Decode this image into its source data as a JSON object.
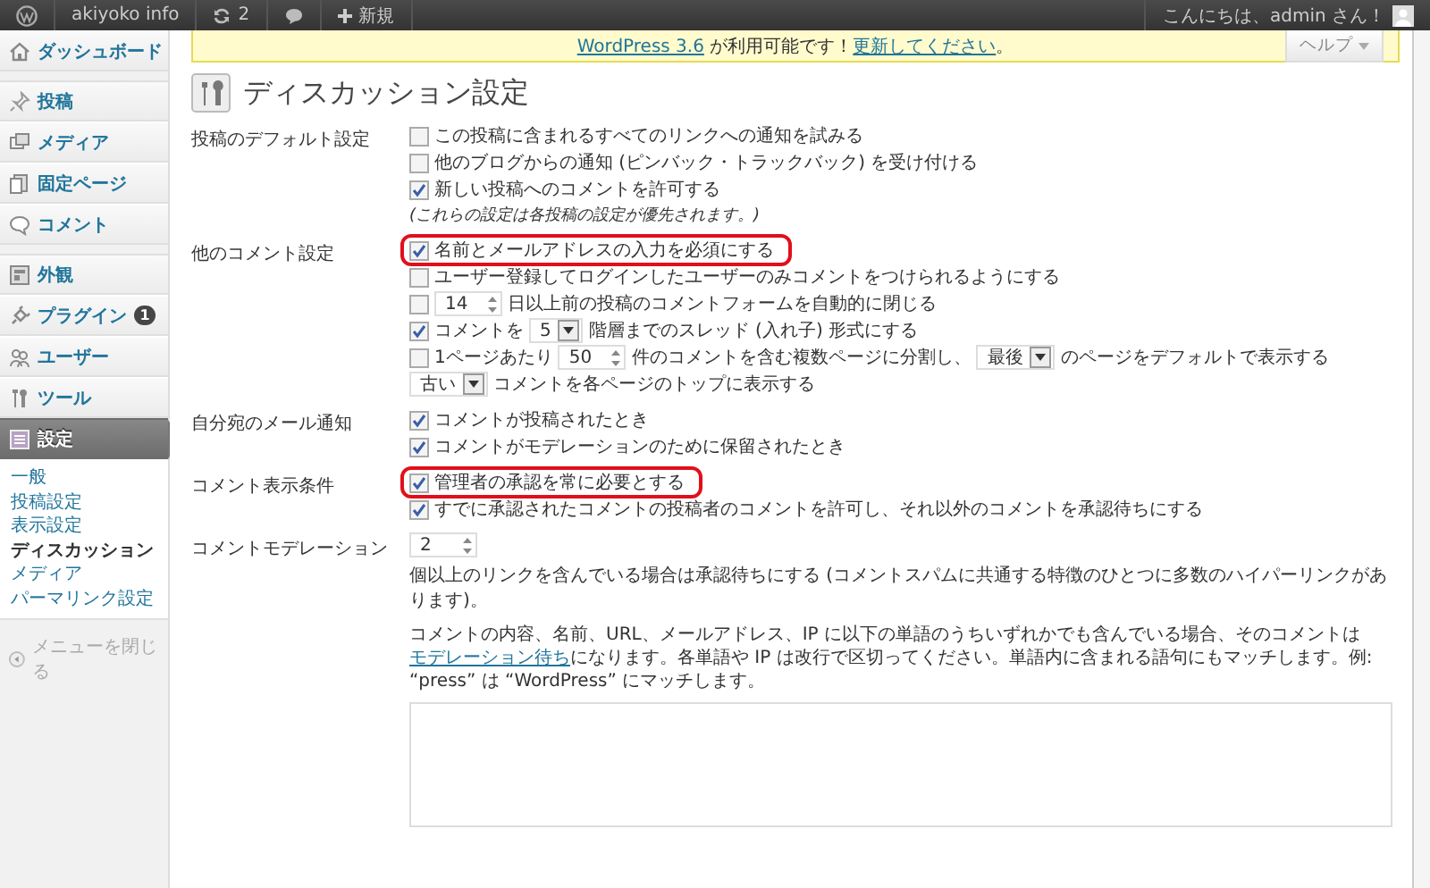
{
  "admin_bar": {
    "site": "akiyoko info",
    "updates": "2",
    "new": "新規",
    "greeting": "こんにちは、admin さん！"
  },
  "sidebar": {
    "items": [
      {
        "label": "ダッシュボード",
        "selected": false
      },
      {
        "label": "投稿",
        "selected": false
      },
      {
        "label": "メディア",
        "selected": false
      },
      {
        "label": "固定ページ",
        "selected": false
      },
      {
        "label": "コメント",
        "selected": false
      },
      {
        "label": "外観",
        "selected": false
      },
      {
        "label": "プラグイン",
        "selected": false,
        "badge": "1"
      },
      {
        "label": "ユーザー",
        "selected": false
      },
      {
        "label": "ツール",
        "selected": false
      },
      {
        "label": "設定",
        "selected": true
      }
    ],
    "submenu": [
      {
        "label": "一般",
        "selected": false
      },
      {
        "label": "投稿設定",
        "selected": false
      },
      {
        "label": "表示設定",
        "selected": false
      },
      {
        "label": "ディスカッション",
        "selected": true
      },
      {
        "label": "メディア",
        "selected": false
      },
      {
        "label": "パーマリンク設定",
        "selected": false
      }
    ],
    "collapse": "メニューを閉じる"
  },
  "notice": {
    "parts": [
      {
        "kind": "link",
        "text": "WordPress 3.6"
      },
      {
        "kind": "text",
        "text": " が利用可能です！"
      },
      {
        "kind": "link",
        "text": "更新してください"
      },
      {
        "kind": "text",
        "text": "。"
      }
    ]
  },
  "help_button": "ヘルプ",
  "page_title": "ディスカッション設定",
  "sections": [
    {
      "label": "投稿のデフォルト設定",
      "options": [
        {
          "kind": "checkbox",
          "checked": false,
          "highlighted": false,
          "parts": [
            {
              "kind": "text",
              "text": "この投稿に含まれるすべてのリンクへの通知を試みる"
            }
          ]
        },
        {
          "kind": "checkbox",
          "checked": false,
          "highlighted": false,
          "parts": [
            {
              "kind": "text",
              "text": "他のブログからの通知 (ピンバック・トラックバック) を受け付ける"
            }
          ]
        },
        {
          "kind": "checkbox",
          "checked": true,
          "highlighted": false,
          "parts": [
            {
              "kind": "text",
              "text": "新しい投稿へのコメントを許可する"
            }
          ]
        },
        {
          "kind": "note",
          "parts": [
            {
              "kind": "text",
              "text": "(これらの設定は各投稿の設定が優先されます。)"
            }
          ]
        }
      ]
    },
    {
      "label": "他のコメント設定",
      "options": [
        {
          "kind": "checkbox",
          "checked": true,
          "highlighted": true,
          "parts": [
            {
              "kind": "text",
              "text": "名前とメールアドレスの入力を必須にする"
            }
          ]
        },
        {
          "kind": "checkbox",
          "checked": false,
          "highlighted": false,
          "parts": [
            {
              "kind": "text",
              "text": "ユーザー登録してログインしたユーザーのみコメントをつけられるようにする"
            }
          ]
        },
        {
          "kind": "checkbox",
          "checked": false,
          "highlighted": false,
          "parts": [
            {
              "kind": "number",
              "value": "14"
            },
            {
              "kind": "text",
              "text": "日以上前の投稿のコメントフォームを自動的に閉じる"
            }
          ]
        },
        {
          "kind": "checkbox",
          "checked": true,
          "highlighted": false,
          "parts": [
            {
              "kind": "text",
              "text": "コメントを"
            },
            {
              "kind": "select",
              "value": "5"
            },
            {
              "kind": "text",
              "text": "階層までのスレッド (入れ子) 形式にする"
            }
          ]
        },
        {
          "kind": "checkbox",
          "checked": false,
          "highlighted": false,
          "parts": [
            {
              "kind": "text",
              "text": "1ページあたり"
            },
            {
              "kind": "number",
              "value": "50"
            },
            {
              "kind": "text",
              "text": "件のコメントを含む複数ページに分割し、"
            },
            {
              "kind": "select",
              "value": "最後"
            },
            {
              "kind": "text",
              "text": "のページをデフォルトで表示する"
            }
          ]
        },
        {
          "kind": "plain",
          "parts": [
            {
              "kind": "select",
              "value": "古い"
            },
            {
              "kind": "text",
              "text": "コメントを各ページのトップに表示する"
            }
          ]
        }
      ]
    },
    {
      "label": "自分宛のメール通知",
      "options": [
        {
          "kind": "checkbox",
          "checked": true,
          "highlighted": false,
          "parts": [
            {
              "kind": "text",
              "text": "コメントが投稿されたとき"
            }
          ]
        },
        {
          "kind": "checkbox",
          "checked": true,
          "highlighted": false,
          "parts": [
            {
              "kind": "text",
              "text": "コメントがモデレーションのために保留されたとき"
            }
          ]
        }
      ]
    },
    {
      "label": "コメント表示条件",
      "options": [
        {
          "kind": "checkbox",
          "checked": true,
          "highlighted": true,
          "parts": [
            {
              "kind": "text",
              "text": "管理者の承認を常に必要とする"
            }
          ]
        },
        {
          "kind": "checkbox",
          "checked": true,
          "highlighted": false,
          "parts": [
            {
              "kind": "text",
              "text": "すでに承認されたコメントの投稿者のコメントを許可し、それ以外のコメントを承認待ちにする"
            }
          ]
        }
      ]
    },
    {
      "label": "コメントモデレーション",
      "options": [
        {
          "kind": "plain",
          "parts": [
            {
              "kind": "number",
              "value": "2"
            },
            {
              "kind": "text",
              "text": "個以上のリンクを含んでいる場合は承認待ちにする (コメントスパムに共通する特徴のひとつに多数のハイパーリンクがあります)。"
            }
          ]
        },
        {
          "kind": "paragraph",
          "parts": [
            {
              "kind": "text",
              "text": "コメントの内容、名前、URL、メールアドレス、IP に以下の単語のうちいずれかでも含んでいる場合、そのコメントは"
            },
            {
              "kind": "link",
              "text": "モデレーション待ち"
            },
            {
              "kind": "text",
              "text": "になります。各単語や IP は改行で区切ってください。単語内に含まれる語句にもマッチします。例: “press” は “WordPress” にマッチします。"
            }
          ]
        },
        {
          "kind": "textarea"
        }
      ]
    }
  ]
}
